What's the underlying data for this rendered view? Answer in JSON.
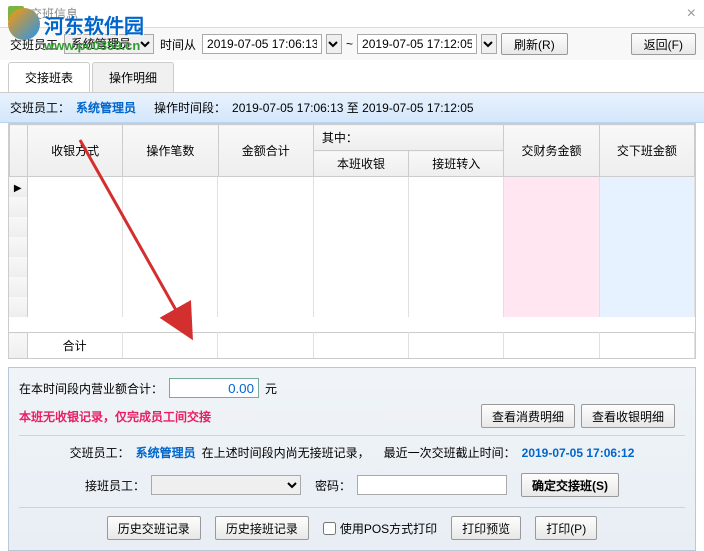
{
  "window": {
    "title": "交班信息"
  },
  "watermark": {
    "name": "河东软件园",
    "url": "www.pc0359.cn"
  },
  "toolbar": {
    "staff_label": "交班员工",
    "staff_value": "系统管理员",
    "time_label": "时间从",
    "time_from": "2019-07-05 17:06:13",
    "time_sep": "~",
    "time_to": "2019-07-05 17:12:05",
    "refresh": "刷新(R)",
    "back": "返回(F)"
  },
  "tabs": {
    "t1": "交接班表",
    "t2": "操作明细"
  },
  "infobar": {
    "staff_label": "交班员工：",
    "staff_value": "系统管理员",
    "period_label": "操作时间段：",
    "period_value": "2019-07-05 17:06:13 至 2019-07-05 17:12:05"
  },
  "grid": {
    "headers": {
      "cashtype": "收银方式",
      "opcount": "操作笔数",
      "amount": "金额合计",
      "among": "其中：",
      "self": "本班收银",
      "trans": "接班转入",
      "finance": "交财务金额",
      "next": "交下班金额"
    },
    "sum": "合计"
  },
  "bottom": {
    "period_total_label": "在本时间段内营业额合计：",
    "period_total_value": "0.00",
    "yuan": "元",
    "no_record": "本班无收银记录，仅完成员工间交接",
    "view_consume": "查看消费明细",
    "view_cash": "查看收银明细",
    "shift_info_1": "交班员工：",
    "shift_staff": "系统管理员",
    "shift_info_2": "在上述时间段内尚无接班记录，",
    "shift_info_3": "最近一次交班截止时间：",
    "shift_time": "2019-07-05 17:06:12",
    "take_label": "接班员工：",
    "pwd_label": "密码：",
    "confirm": "确定交接班(S)",
    "hist_shift": "历史交班记录",
    "hist_take": "历史接班记录",
    "use_pos": "使用POS方式打印",
    "preview": "打印预览",
    "print": "打印(P)"
  }
}
